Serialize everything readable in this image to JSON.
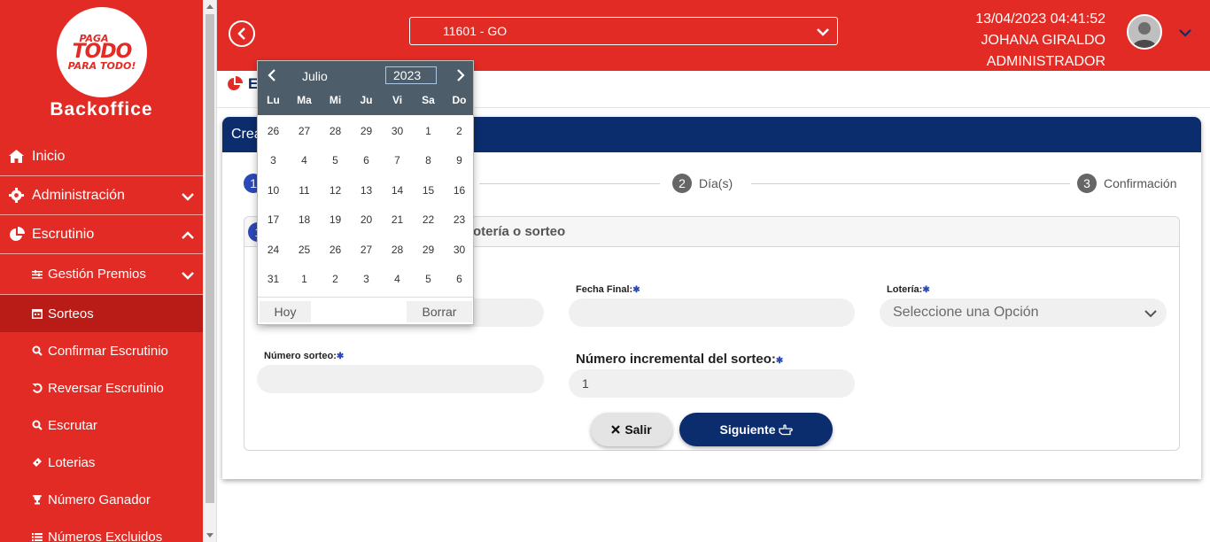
{
  "sidebar": {
    "logo": {
      "line1": "PAGA",
      "line2": "TODO",
      "line3": "PARA TODO!"
    },
    "brand": "Backoffice",
    "menu": [
      {
        "label": "Inicio",
        "icon": "home-icon"
      },
      {
        "label": "Administración",
        "icon": "gear-icon"
      },
      {
        "label": "Escrutinio",
        "icon": "pie-chart-icon"
      }
    ],
    "submenu": [
      {
        "label": "Gestión Premios",
        "icon": "sliders-icon"
      },
      {
        "label": "Sorteos",
        "icon": "calendar-icon"
      },
      {
        "label": "Confirmar Escrutinio",
        "icon": "search-icon"
      },
      {
        "label": "Reversar Escrutinio",
        "icon": "undo-icon"
      },
      {
        "label": "Escrutar",
        "icon": "search-icon"
      },
      {
        "label": "Loterias",
        "icon": "ticket-icon"
      },
      {
        "label": "Número Ganador",
        "icon": "trophy-icon"
      },
      {
        "label": "Números Excluidos",
        "icon": "list-icon"
      }
    ]
  },
  "header": {
    "store": "11601 - GO",
    "datetime": "13/04/2023 04:41:52",
    "user_name": "JOHANA GIRALDO",
    "role": "ADMINISTRADOR"
  },
  "breadcrumb": {
    "text": "E"
  },
  "card": {
    "title": "Crea",
    "steps": [
      {
        "num": "1",
        "label": ""
      },
      {
        "num": "2",
        "label": "Día(s)"
      },
      {
        "num": "3",
        "label": "Confirmación"
      }
    ],
    "section": {
      "num": "1",
      "title": "otería o sorteo"
    },
    "fields": {
      "fecha_final_label": "Fecha Final:",
      "loteria_label": "Lotería:",
      "loteria_placeholder": "Seleccione una Opción",
      "numero_sorteo_label": "Número sorteo:",
      "numero_incremental_label": "Número incremental del sorteo:",
      "numero_incremental_value": "1",
      "required_mark": "✱"
    },
    "buttons": {
      "exit": "Salir",
      "next": "Siguiente"
    }
  },
  "datepicker": {
    "month": "Julio",
    "year": "2023",
    "dows": [
      "Lu",
      "Ma",
      "Mi",
      "Ju",
      "Vi",
      "Sa",
      "Do"
    ],
    "weeks": [
      [
        "26",
        "27",
        "28",
        "29",
        "30",
        "1",
        "2"
      ],
      [
        "3",
        "4",
        "5",
        "6",
        "7",
        "8",
        "9"
      ],
      [
        "10",
        "11",
        "12",
        "13",
        "14",
        "15",
        "16"
      ],
      [
        "17",
        "18",
        "19",
        "20",
        "21",
        "22",
        "23"
      ],
      [
        "24",
        "25",
        "26",
        "27",
        "28",
        "29",
        "30"
      ],
      [
        "31",
        "1",
        "2",
        "3",
        "4",
        "5",
        "6"
      ]
    ],
    "today_label": "Hoy",
    "clear_label": "Borrar"
  },
  "colors": {
    "primary_red": "#e32b25",
    "navy": "#0b2d6e",
    "step_blue": "#2b49b8"
  }
}
